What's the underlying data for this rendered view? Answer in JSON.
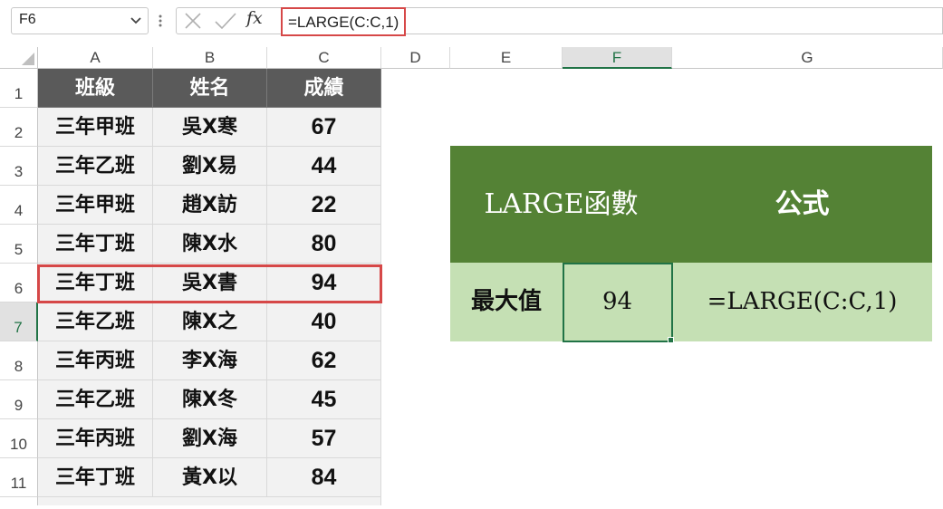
{
  "formula_bar": {
    "name_box": "F6",
    "fx_label": "fx",
    "formula": "=LARGE(C:C,1)"
  },
  "columns": [
    "A",
    "B",
    "C",
    "D",
    "E",
    "F",
    "G"
  ],
  "selected_column": "F",
  "rows": [
    "1",
    "2",
    "3",
    "4",
    "5",
    "6",
    "7",
    "8",
    "9",
    "10",
    "11"
  ],
  "selected_row": "7",
  "table": {
    "headers": [
      "班級",
      "姓名",
      "成績"
    ],
    "records": [
      [
        "三年甲班",
        "吳X寒",
        "67"
      ],
      [
        "三年乙班",
        "劉X易",
        "44"
      ],
      [
        "三年甲班",
        "趙X訪",
        "22"
      ],
      [
        "三年丁班",
        "陳X水",
        "80"
      ],
      [
        "三年丁班",
        "吳X書",
        "94"
      ],
      [
        "三年乙班",
        "陳X之",
        "40"
      ],
      [
        "三年丙班",
        "李X海",
        "62"
      ],
      [
        "三年乙班",
        "陳X冬",
        "45"
      ],
      [
        "三年丙班",
        "劉X海",
        "57"
      ],
      [
        "三年丁班",
        "黃X以",
        "84"
      ]
    ],
    "highlighted_record_index": 4
  },
  "summary": {
    "header_left": "LARGE函數",
    "header_right": "公式",
    "label": "最大值",
    "value": "94",
    "formula": "=LARGE(C:C,1)"
  },
  "colors": {
    "header_gray": "#5a5a5a",
    "green_dark": "#548235",
    "green_light": "#c5e0b4",
    "highlight_red": "#d64848",
    "excel_green": "#217346"
  }
}
